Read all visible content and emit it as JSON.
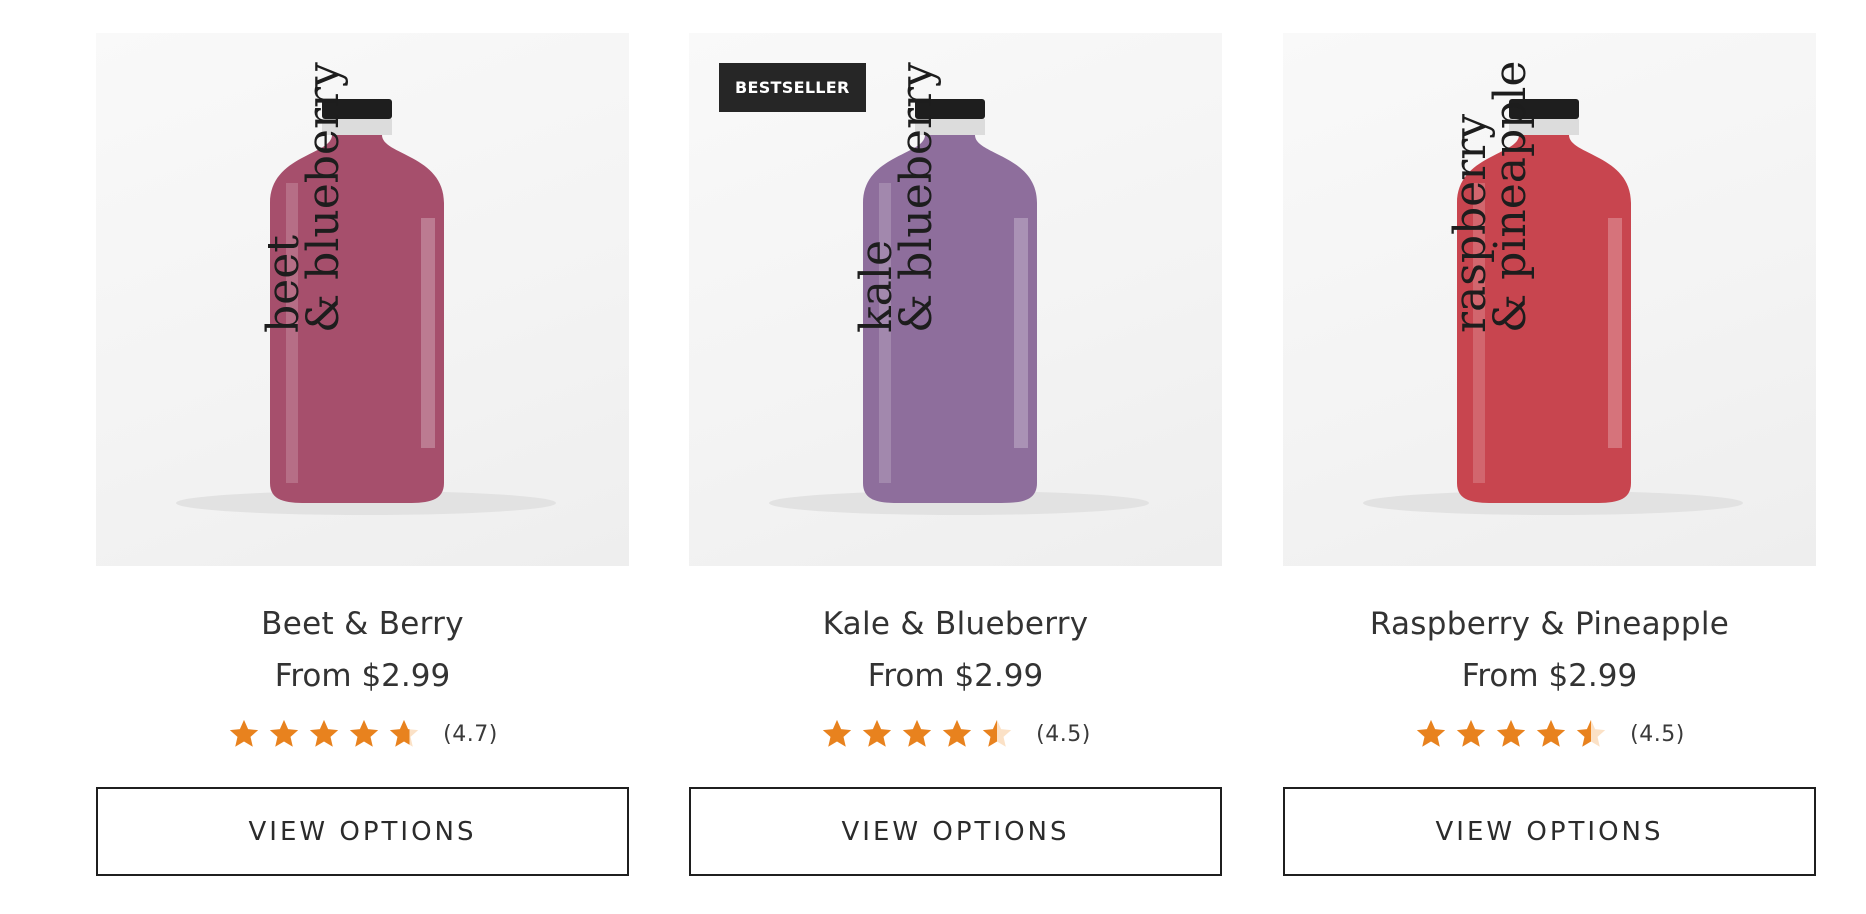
{
  "colors": {
    "star_fill": "#E8821E",
    "star_empty": "#FBE1C6",
    "badge_bg": "#262626",
    "button_border": "#1f1f1f"
  },
  "products": [
    {
      "name": "Beet & Berry",
      "price": "From $2.99",
      "rating": 4.7,
      "rating_text": "(4.7)",
      "badge": "",
      "bottle_color": "#A64F6C",
      "label_line1": "beet",
      "label_line2": "& blueberry",
      "button_label": "VIEW OPTIONS"
    },
    {
      "name": "Kale & Blueberry",
      "price": "From $2.99",
      "rating": 4.5,
      "rating_text": "(4.5)",
      "badge": "BESTSELLER",
      "bottle_color": "#8E6E9C",
      "label_line1": "kale",
      "label_line2": "& blueberry",
      "button_label": "VIEW OPTIONS"
    },
    {
      "name": "Raspberry & Pineapple",
      "price": "From $2.99",
      "rating": 4.5,
      "rating_text": "(4.5)",
      "badge": "",
      "bottle_color": "#C8454F",
      "label_line1": "raspberry",
      "label_line2": "& pineapple",
      "button_label": "VIEW OPTIONS"
    }
  ]
}
